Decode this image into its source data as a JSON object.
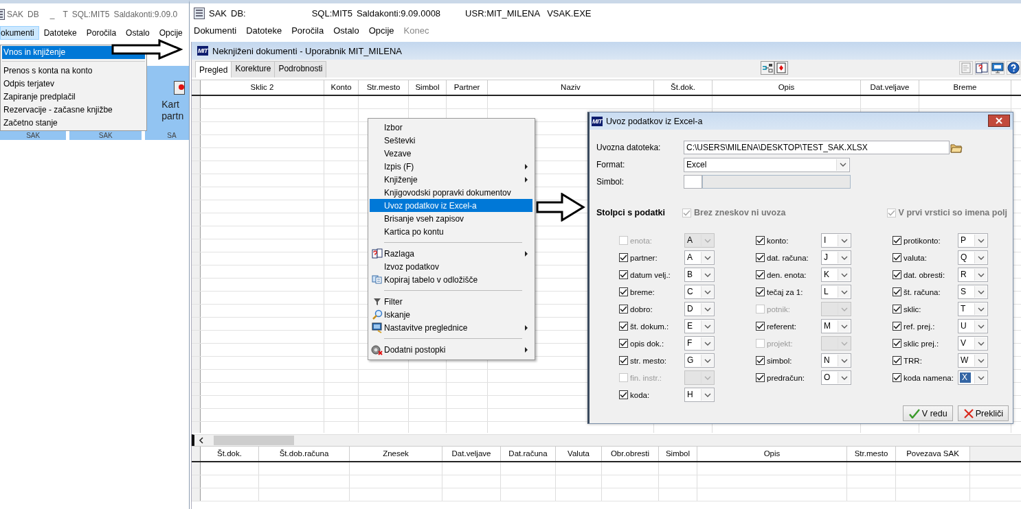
{
  "back_window": {
    "title": [
      "SAK",
      "DB",
      "_",
      "T",
      "SQL:MIT5",
      "Saldakonti:9.09.0"
    ],
    "menu": [
      {
        "label": "okumenti",
        "selected": true
      },
      {
        "label": "Datoteke",
        "selected": false
      },
      {
        "label": "Poročila",
        "selected": false
      },
      {
        "label": "Ostalo",
        "selected": false
      },
      {
        "label": "Opcije",
        "selected": false
      }
    ],
    "tiles": [
      {
        "caption": "SAK"
      },
      {
        "caption": "SAK"
      },
      {
        "lines": [
          "Kart",
          "partn"
        ],
        "caption": "SA"
      }
    ],
    "dropdown": [
      {
        "kind": "item",
        "label": "Vnos in knjiženje",
        "selected": true
      },
      {
        "kind": "separator"
      },
      {
        "kind": "item",
        "label": "Prenos s konta na konto",
        "selected": false
      },
      {
        "kind": "item",
        "label": "Odpis terjatev",
        "selected": false
      },
      {
        "kind": "item",
        "label": "Zapiranje predplačil",
        "selected": false
      },
      {
        "kind": "item",
        "label": "Rezervacije - začasne knjižbe",
        "selected": false
      },
      {
        "kind": "item",
        "label": "Začetno stanje",
        "selected": false
      }
    ]
  },
  "window": {
    "title": [
      "SAK",
      "DB:",
      "SQL:MIT5",
      "Saldakonti:9.09.0008",
      "USR:MIT_MILENA",
      "VSAK.EXE"
    ],
    "menu": [
      {
        "label": "Dokumenti",
        "disabled": false
      },
      {
        "label": "Datoteke",
        "disabled": false
      },
      {
        "label": "Poročila",
        "disabled": false
      },
      {
        "label": "Ostalo",
        "disabled": false
      },
      {
        "label": "Opcije",
        "disabled": false
      },
      {
        "label": "Konec",
        "disabled": true
      }
    ]
  },
  "document": {
    "logo": "MIT",
    "title": "Neknjiženi dokumenti - Uporabnik MIT_MILENA",
    "tabs": [
      {
        "label": "Pregled",
        "selected": true
      },
      {
        "label": "Korekture",
        "selected": false
      },
      {
        "label": "Podrobnosti",
        "selected": false
      }
    ],
    "table": {
      "columns": [
        "Sklic 2",
        "Konto",
        "Str.mesto",
        "Simbol",
        "Partner",
        "Naziv",
        "Št.dok.",
        "Opis",
        "Dat.veljave",
        "Breme"
      ]
    },
    "detail_table": {
      "columns": [
        "Št.dok.",
        "Št.dob.računa",
        "Znesek",
        "Dat.veljave",
        "Dat.računa",
        "Valuta",
        "Obr.obresti",
        "Simbol",
        "Opis",
        "Str.mesto",
        "Povezava SAK"
      ]
    }
  },
  "context_menu": [
    {
      "kind": "item",
      "label": "Izbor",
      "submenu": false,
      "selected": false
    },
    {
      "kind": "item",
      "label": "Seštevki",
      "submenu": false,
      "selected": false
    },
    {
      "kind": "item",
      "label": "Vezave",
      "submenu": false,
      "selected": false
    },
    {
      "kind": "item",
      "label": "Izpis (F)",
      "submenu": true,
      "selected": false
    },
    {
      "kind": "item",
      "label": "Knjiženje",
      "submenu": true,
      "selected": false
    },
    {
      "kind": "item",
      "label": "Knjigovodski popravki dokumentov",
      "submenu": false,
      "selected": false
    },
    {
      "kind": "item",
      "label": "Uvoz podatkov iz Excel-a",
      "submenu": false,
      "selected": true
    },
    {
      "kind": "item",
      "label": "Brisanje vseh zapisov",
      "submenu": false,
      "selected": false
    },
    {
      "kind": "item",
      "label": "Kartica po kontu",
      "submenu": false,
      "selected": false
    },
    {
      "kind": "separator"
    },
    {
      "kind": "item",
      "label": "Razlaga",
      "submenu": true,
      "selected": false
    },
    {
      "kind": "item",
      "label": "Izvoz podatkov",
      "submenu": false,
      "selected": false
    },
    {
      "kind": "item",
      "label": "Kopiraj tabelo v odložišče",
      "submenu": false,
      "selected": false
    },
    {
      "kind": "separator"
    },
    {
      "kind": "item",
      "label": "Filter",
      "submenu": false,
      "selected": false
    },
    {
      "kind": "item",
      "label": "Iskanje",
      "submenu": false,
      "selected": false
    },
    {
      "kind": "item",
      "label": "Nastavitve preglednice",
      "submenu": true,
      "selected": false
    },
    {
      "kind": "separator"
    },
    {
      "kind": "item",
      "label": "Dodatni postopki",
      "submenu": true,
      "selected": false
    }
  ],
  "dialog": {
    "logo": "MIT",
    "title": "Uvoz podatkov iz Excel-a",
    "fields": [
      {
        "kind": "file",
        "label": "Uvozna datoteka:",
        "value": "C:\\USERS\\MILENA\\DESKTOP\\TEST_SAK.XLSX"
      },
      {
        "kind": "select",
        "label": "Format:",
        "value": "Excel"
      },
      {
        "kind": "symbol",
        "label": "Simbol:"
      }
    ],
    "section": "Stolpci s podatki",
    "options": [
      {
        "label": "Brez zneskov ni uvoza",
        "checked": true,
        "disabled": true
      },
      {
        "label": "V prvi vrstici so imena polj",
        "checked": true,
        "disabled": true
      }
    ],
    "columns": [
      {
        "rows": [
          {
            "label": "enota:",
            "checked": false,
            "disabled": true,
            "letter": "A",
            "selected": false
          },
          {
            "label": "partner:",
            "checked": true,
            "disabled": false,
            "letter": "A",
            "selected": false
          },
          {
            "label": "datum velj.:",
            "checked": true,
            "disabled": false,
            "letter": "B",
            "selected": false
          },
          {
            "label": "breme:",
            "checked": true,
            "disabled": false,
            "letter": "C",
            "selected": false
          },
          {
            "label": "dobro:",
            "checked": true,
            "disabled": false,
            "letter": "D",
            "selected": false
          },
          {
            "label": "št. dokum.:",
            "checked": true,
            "disabled": false,
            "letter": "E",
            "selected": false
          },
          {
            "label": "opis dok.:",
            "checked": true,
            "disabled": false,
            "letter": "F",
            "selected": false
          },
          {
            "label": "str. mesto:",
            "checked": true,
            "disabled": false,
            "letter": "G",
            "selected": false
          },
          {
            "label": "fin. instr.:",
            "checked": false,
            "disabled": true,
            "selected": false
          },
          {
            "label": "koda:",
            "checked": true,
            "disabled": false,
            "letter": "H",
            "selected": false
          }
        ]
      },
      {
        "rows": [
          {
            "label": "konto:",
            "checked": true,
            "disabled": false,
            "letter": "I",
            "selected": false
          },
          {
            "label": "dat. računa:",
            "checked": true,
            "disabled": false,
            "letter": "J",
            "selected": false
          },
          {
            "label": "den. enota:",
            "checked": true,
            "disabled": false,
            "letter": "K",
            "selected": false
          },
          {
            "label": "tečaj za 1:",
            "checked": true,
            "disabled": false,
            "letter": "L",
            "selected": false
          },
          {
            "label": "potnik:",
            "checked": false,
            "disabled": true,
            "selected": false
          },
          {
            "label": "referent:",
            "checked": true,
            "disabled": false,
            "letter": "M",
            "selected": false
          },
          {
            "label": "projekt:",
            "checked": false,
            "disabled": true,
            "selected": false
          },
          {
            "label": "simbol:",
            "checked": true,
            "disabled": false,
            "letter": "N",
            "selected": false
          },
          {
            "label": "predračun:",
            "checked": true,
            "disabled": false,
            "letter": "O",
            "selected": false
          }
        ]
      },
      {
        "rows": [
          {
            "label": "protikonto:",
            "checked": true,
            "disabled": false,
            "letter": "P",
            "selected": false
          },
          {
            "label": "valuta:",
            "checked": true,
            "disabled": false,
            "letter": "Q",
            "selected": false
          },
          {
            "label": "dat. obresti:",
            "checked": true,
            "disabled": false,
            "letter": "R",
            "selected": false
          },
          {
            "label": "št. računa:",
            "checked": true,
            "disabled": false,
            "letter": "S",
            "selected": false
          },
          {
            "label": "sklic:",
            "checked": true,
            "disabled": false,
            "letter": "T",
            "selected": false
          },
          {
            "label": "ref. prej.:",
            "checked": true,
            "disabled": false,
            "letter": "U",
            "selected": false
          },
          {
            "label": "sklic prej.:",
            "checked": true,
            "disabled": false,
            "letter": "V",
            "selected": false
          },
          {
            "label": "TRR:",
            "checked": true,
            "disabled": false,
            "letter": "W",
            "selected": false
          },
          {
            "label": "koda namena:",
            "checked": true,
            "disabled": false,
            "letter": "X",
            "selected": true
          }
        ]
      }
    ],
    "buttons": [
      {
        "kind": "ok",
        "label": "V redu"
      },
      {
        "kind": "cancel",
        "label": "Prekliči"
      }
    ]
  }
}
